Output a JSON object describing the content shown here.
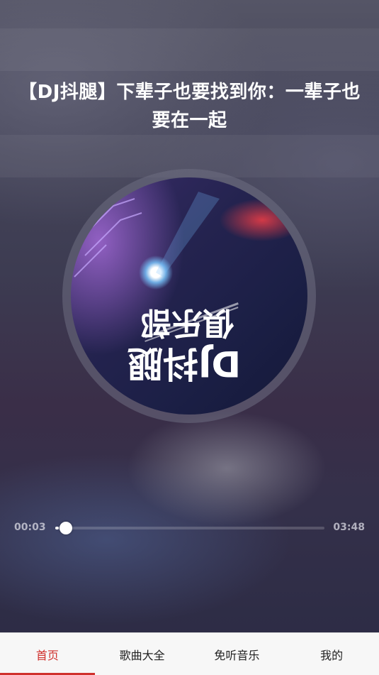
{
  "song": {
    "title": "【DJ抖腿】下辈子也要找到你：一辈子也要在一起",
    "cover_text": "DJ抖腿 俱乐部"
  },
  "player": {
    "current_time": "00:03",
    "total_time": "03:48",
    "progress_fraction": 0.013
  },
  "tabs": [
    {
      "label": "首页",
      "active": true
    },
    {
      "label": "歌曲大全",
      "active": false
    },
    {
      "label": "免听音乐",
      "active": false
    },
    {
      "label": "我的",
      "active": false
    }
  ],
  "colors": {
    "accent": "#d0302c",
    "tabbar_bg": "#f7f7f7",
    "text_light": "#ffffff"
  }
}
